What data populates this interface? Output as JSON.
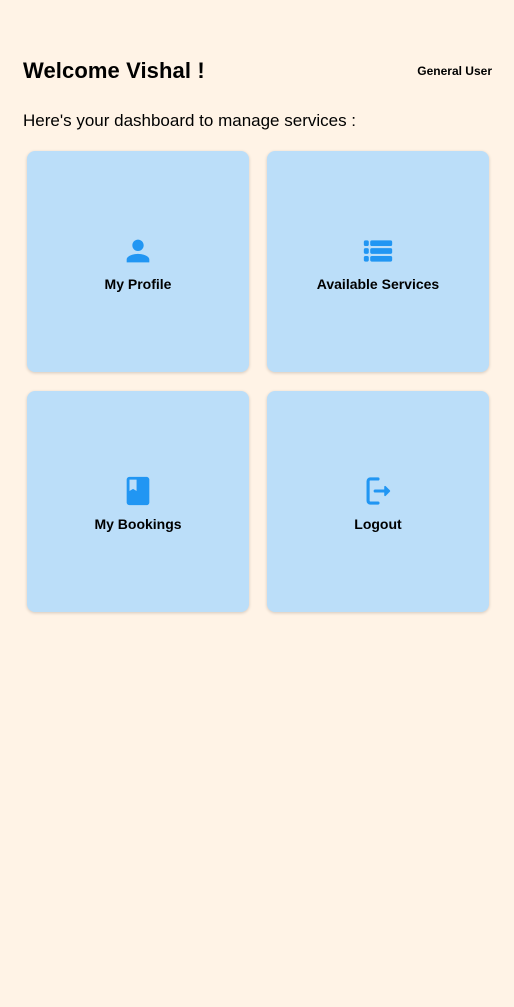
{
  "header": {
    "welcome": "Welcome Vishal !",
    "role": "General User"
  },
  "subtitle": "Here's your dashboard to manage services :",
  "accent_color": "#2196F3",
  "tile_color": "#BBDEF9",
  "background_color": "#FFF3E6",
  "tiles": [
    {
      "label": "My Profile",
      "icon": "person-icon"
    },
    {
      "label": "Available Services",
      "icon": "list-icon"
    },
    {
      "label": "My Bookings",
      "icon": "book-icon"
    },
    {
      "label": "Logout",
      "icon": "logout-icon"
    }
  ]
}
